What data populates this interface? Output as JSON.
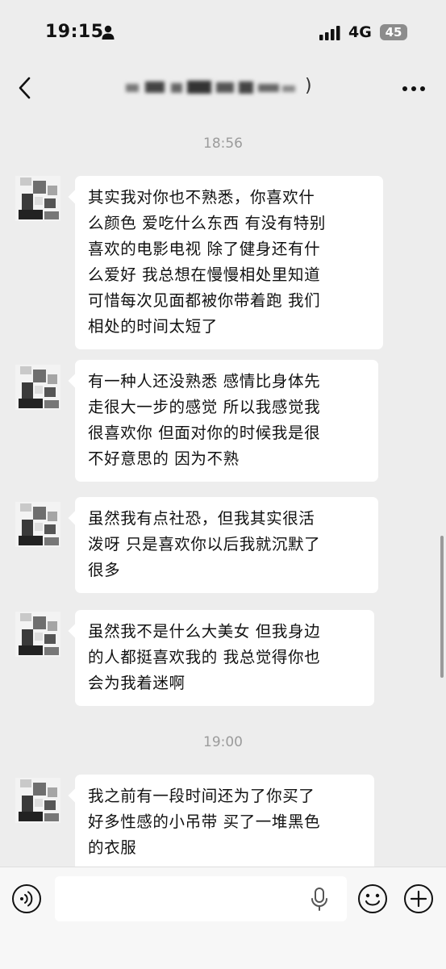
{
  "status_bar": {
    "time": "19:15",
    "network": "4G",
    "battery": "45"
  },
  "nav": {
    "contact_suffix": ")"
  },
  "messages": [
    {
      "type": "timestamp",
      "text": "18:56"
    },
    {
      "type": "incoming",
      "lines": [
        "其实我对你也不熟悉，你喜欢什",
        "么颜色 爱吃什么东西 有没有特别",
        "喜欢的电影电视 除了健身还有什",
        "么爱好 我总想在慢慢相处里知道",
        "可惜每次见面都被你带着跑 我们",
        "相处的时间太短了"
      ]
    },
    {
      "type": "incoming",
      "lines": [
        "有一种人还没熟悉 感情比身体先",
        "走很大一步的感觉 所以我感觉我",
        "很喜欢你  但面对你的时候我是很",
        "不好意思的 因为不熟"
      ]
    },
    {
      "type": "incoming",
      "lines": [
        "虽然我有点社恐，但我其实很活",
        "泼呀  只是喜欢你以后我就沉默了",
        "很多"
      ]
    },
    {
      "type": "incoming",
      "lines": [
        "虽然我不是什么大美女 但我身边",
        "的人都挺喜欢我的 我总觉得你也",
        "会为我着迷啊"
      ]
    },
    {
      "type": "timestamp",
      "text": "19:00"
    },
    {
      "type": "incoming",
      "lines": [
        "我之前有一段时间还为了你买了",
        "好多性感的小吊带 买了一堆黑色",
        "的衣服"
      ]
    }
  ],
  "colors": {
    "background": "#ededed",
    "bubble": "#ffffff",
    "timestamp": "#9b9b9b",
    "input_bar": "#f7f7f7"
  },
  "icons": [
    "person-icon",
    "signal-icon",
    "back-icon",
    "more-icon",
    "voice-icon",
    "mic-icon",
    "emoji-icon",
    "add-icon"
  ]
}
